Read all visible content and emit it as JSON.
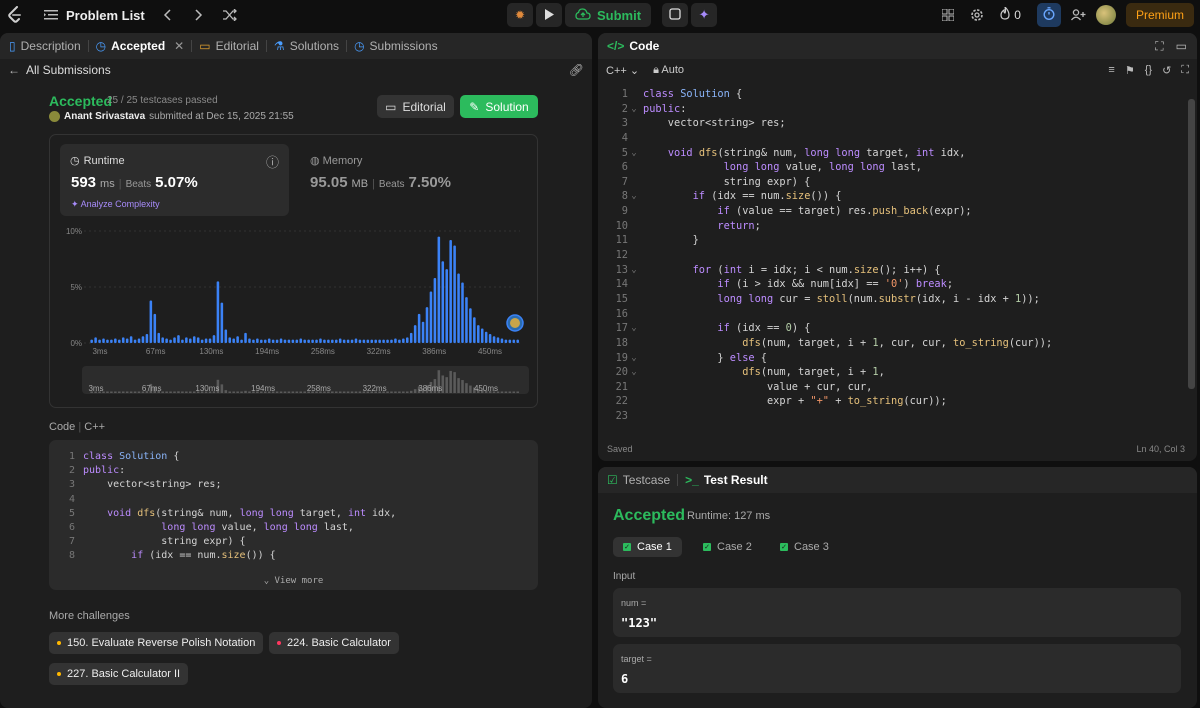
{
  "topbar": {
    "problem_list": "Problem List",
    "submit_label": "Submit",
    "streak_count": "0",
    "premium_label": "Premium"
  },
  "left_tabs": [
    {
      "label": "Description",
      "icon": "document-icon"
    },
    {
      "label": "Accepted",
      "icon": "history-icon"
    },
    {
      "label": "Editorial",
      "icon": "book-icon"
    },
    {
      "label": "Solutions",
      "icon": "flask-icon"
    },
    {
      "label": "Submissions",
      "icon": "history-icon"
    }
  ],
  "submission": {
    "back_label": "All Submissions",
    "status": "Accepted",
    "testcases": "25 / 25 testcases passed",
    "author": "Anant Srivastava",
    "submitted_at": "submitted at Dec 15, 2025 21:55",
    "editorial_btn": "Editorial",
    "solution_btn": "Solution"
  },
  "runtime": {
    "label": "Runtime",
    "value": "593",
    "unit": "ms",
    "beats_label": "Beats",
    "beats": "5.07%",
    "analyze": "Analyze Complexity"
  },
  "memory": {
    "label": "Memory",
    "value": "95.05",
    "unit": "MB",
    "beats_label": "Beats",
    "beats": "7.50%"
  },
  "chart_data": {
    "type": "bar",
    "y_ticks": [
      "10%",
      "5%",
      "0%"
    ],
    "ylim": [
      0,
      10
    ],
    "x_ticks": [
      "3ms",
      "67ms",
      "130ms",
      "194ms",
      "258ms",
      "322ms",
      "386ms",
      "450ms"
    ],
    "values": [
      0.3,
      0.5,
      0.3,
      0.4,
      0.3,
      0.3,
      0.4,
      0.3,
      0.5,
      0.4,
      0.6,
      0.3,
      0.4,
      0.6,
      0.8,
      3.8,
      2.6,
      0.9,
      0.5,
      0.4,
      0.3,
      0.5,
      0.7,
      0.3,
      0.5,
      0.4,
      0.6,
      0.5,
      0.3,
      0.4,
      0.4,
      0.7,
      5.5,
      3.6,
      1.2,
      0.5,
      0.4,
      0.6,
      0.3,
      0.9,
      0.4,
      0.3,
      0.4,
      0.3,
      0.3,
      0.4,
      0.3,
      0.3,
      0.4,
      0.3,
      0.3,
      0.3,
      0.3,
      0.4,
      0.3,
      0.3,
      0.3,
      0.3,
      0.4,
      0.3,
      0.3,
      0.3,
      0.3,
      0.4,
      0.3,
      0.3,
      0.3,
      0.4,
      0.3,
      0.3,
      0.3,
      0.3,
      0.3,
      0.3,
      0.3,
      0.3,
      0.3,
      0.4,
      0.3,
      0.4,
      0.5,
      0.9,
      1.6,
      2.6,
      1.9,
      3.2,
      4.6,
      5.8,
      9.5,
      7.3,
      6.6,
      9.2,
      8.7,
      6.2,
      5.4,
      4.1,
      3.1,
      2.3,
      1.6,
      1.3,
      1.0,
      0.8,
      0.6,
      0.5,
      0.4,
      0.3,
      0.3,
      0.3,
      0.3
    ],
    "highlight_x": "593ms"
  },
  "code_section": {
    "label": "Code",
    "lang": "C++",
    "view_more": "View more",
    "lines": [
      [
        {
          "c": "kw",
          "t": "class"
        },
        {
          "c": "tx",
          "t": " "
        },
        {
          "c": "ty",
          "t": "Solution"
        },
        {
          "c": "tx",
          "t": " {"
        }
      ],
      [
        {
          "c": "kw",
          "t": "public"
        },
        {
          "c": "tx",
          "t": ":"
        }
      ],
      [
        {
          "c": "tx",
          "t": "    vector<string> res;"
        }
      ],
      [
        {
          "c": "tx",
          "t": ""
        }
      ],
      [
        {
          "c": "tx",
          "t": "    "
        },
        {
          "c": "kw",
          "t": "void"
        },
        {
          "c": "tx",
          "t": " "
        },
        {
          "c": "fn",
          "t": "dfs"
        },
        {
          "c": "tx",
          "t": "(string& num, "
        },
        {
          "c": "kw",
          "t": "long long"
        },
        {
          "c": "tx",
          "t": " target, "
        },
        {
          "c": "kw",
          "t": "int"
        },
        {
          "c": "tx",
          "t": " idx,"
        }
      ],
      [
        {
          "c": "tx",
          "t": "             "
        },
        {
          "c": "kw",
          "t": "long long"
        },
        {
          "c": "tx",
          "t": " value, "
        },
        {
          "c": "kw",
          "t": "long long"
        },
        {
          "c": "tx",
          "t": " last,"
        }
      ],
      [
        {
          "c": "tx",
          "t": "             string expr) {"
        }
      ],
      [
        {
          "c": "tx",
          "t": "        "
        },
        {
          "c": "kw",
          "t": "if"
        },
        {
          "c": "tx",
          "t": " (idx == num."
        },
        {
          "c": "fn",
          "t": "size"
        },
        {
          "c": "tx",
          "t": "()) {"
        }
      ]
    ]
  },
  "more_challenges": {
    "label": "More challenges",
    "items": [
      {
        "label": "150. Evaluate Reverse Polish Notation",
        "level": "medium"
      },
      {
        "label": "224. Basic Calculator",
        "level": "hard"
      },
      {
        "label": "227. Basic Calculator II",
        "level": "medium"
      }
    ]
  },
  "editor": {
    "title": "Code",
    "language": "C++",
    "mode": "Auto",
    "status": "Saved",
    "cursor": "Ln 40, Col 3",
    "lines": [
      {
        "n": "1",
        "f": "",
        "s": [
          {
            "c": "kw",
            "t": "class"
          },
          {
            "c": "tx",
            "t": " "
          },
          {
            "c": "ty",
            "t": "Solution"
          },
          {
            "c": "tx",
            "t": " {"
          }
        ]
      },
      {
        "n": "2",
        "f": "v",
        "s": [
          {
            "c": "kw",
            "t": "public"
          },
          {
            "c": "tx",
            "t": ":"
          }
        ]
      },
      {
        "n": "3",
        "f": "",
        "s": [
          {
            "c": "tx",
            "t": "    vector<string> res;"
          }
        ]
      },
      {
        "n": "4",
        "f": "",
        "s": [
          {
            "c": "tx",
            "t": ""
          }
        ]
      },
      {
        "n": "5",
        "f": "v",
        "s": [
          {
            "c": "tx",
            "t": "    "
          },
          {
            "c": "kw",
            "t": "void"
          },
          {
            "c": "tx",
            "t": " "
          },
          {
            "c": "fn",
            "t": "dfs"
          },
          {
            "c": "tx",
            "t": "(string& num, "
          },
          {
            "c": "kw",
            "t": "long long"
          },
          {
            "c": "tx",
            "t": " target, "
          },
          {
            "c": "kw",
            "t": "int"
          },
          {
            "c": "tx",
            "t": " idx,"
          }
        ]
      },
      {
        "n": "6",
        "f": "",
        "s": [
          {
            "c": "tx",
            "t": "             "
          },
          {
            "c": "kw",
            "t": "long long"
          },
          {
            "c": "tx",
            "t": " value, "
          },
          {
            "c": "kw",
            "t": "long long"
          },
          {
            "c": "tx",
            "t": " last,"
          }
        ]
      },
      {
        "n": "7",
        "f": "",
        "s": [
          {
            "c": "tx",
            "t": "             string expr) {"
          }
        ]
      },
      {
        "n": "8",
        "f": "v",
        "s": [
          {
            "c": "tx",
            "t": "        "
          },
          {
            "c": "kw",
            "t": "if"
          },
          {
            "c": "tx",
            "t": " (idx == num."
          },
          {
            "c": "fn",
            "t": "size"
          },
          {
            "c": "tx",
            "t": "()) {"
          }
        ]
      },
      {
        "n": "9",
        "f": "",
        "s": [
          {
            "c": "tx",
            "t": "            "
          },
          {
            "c": "kw",
            "t": "if"
          },
          {
            "c": "tx",
            "t": " (value == target) res."
          },
          {
            "c": "fn",
            "t": "push_back"
          },
          {
            "c": "tx",
            "t": "(expr);"
          }
        ]
      },
      {
        "n": "10",
        "f": "",
        "s": [
          {
            "c": "tx",
            "t": "            "
          },
          {
            "c": "kw",
            "t": "return"
          },
          {
            "c": "tx",
            "t": ";"
          }
        ]
      },
      {
        "n": "11",
        "f": "",
        "s": [
          {
            "c": "tx",
            "t": "        }"
          }
        ]
      },
      {
        "n": "12",
        "f": "",
        "s": [
          {
            "c": "tx",
            "t": ""
          }
        ]
      },
      {
        "n": "13",
        "f": "v",
        "s": [
          {
            "c": "tx",
            "t": "        "
          },
          {
            "c": "kw",
            "t": "for"
          },
          {
            "c": "tx",
            "t": " ("
          },
          {
            "c": "kw",
            "t": "int"
          },
          {
            "c": "tx",
            "t": " i = idx; i < num."
          },
          {
            "c": "fn",
            "t": "size"
          },
          {
            "c": "tx",
            "t": "(); i++) {"
          }
        ]
      },
      {
        "n": "14",
        "f": "",
        "s": [
          {
            "c": "tx",
            "t": "            "
          },
          {
            "c": "kw",
            "t": "if"
          },
          {
            "c": "tx",
            "t": " (i > idx && num[idx] == "
          },
          {
            "c": "st",
            "t": "'0'"
          },
          {
            "c": "tx",
            "t": ") "
          },
          {
            "c": "kw",
            "t": "break"
          },
          {
            "c": "tx",
            "t": ";"
          }
        ]
      },
      {
        "n": "15",
        "f": "",
        "s": [
          {
            "c": "tx",
            "t": "            "
          },
          {
            "c": "kw",
            "t": "long long"
          },
          {
            "c": "tx",
            "t": " cur = "
          },
          {
            "c": "fn",
            "t": "stoll"
          },
          {
            "c": "tx",
            "t": "(num."
          },
          {
            "c": "fn",
            "t": "substr"
          },
          {
            "c": "tx",
            "t": "(idx, i - idx + "
          },
          {
            "c": "nm",
            "t": "1"
          },
          {
            "c": "tx",
            "t": "));"
          }
        ]
      },
      {
        "n": "16",
        "f": "",
        "s": [
          {
            "c": "tx",
            "t": ""
          }
        ]
      },
      {
        "n": "17",
        "f": "v",
        "s": [
          {
            "c": "tx",
            "t": "            "
          },
          {
            "c": "kw",
            "t": "if"
          },
          {
            "c": "tx",
            "t": " (idx == "
          },
          {
            "c": "nm",
            "t": "0"
          },
          {
            "c": "tx",
            "t": ") {"
          }
        ]
      },
      {
        "n": "18",
        "f": "",
        "s": [
          {
            "c": "tx",
            "t": "                "
          },
          {
            "c": "fn",
            "t": "dfs"
          },
          {
            "c": "tx",
            "t": "(num, target, i + "
          },
          {
            "c": "nm",
            "t": "1"
          },
          {
            "c": "tx",
            "t": ", cur, cur, "
          },
          {
            "c": "fn",
            "t": "to_string"
          },
          {
            "c": "tx",
            "t": "(cur));"
          }
        ]
      },
      {
        "n": "19",
        "f": "v",
        "s": [
          {
            "c": "tx",
            "t": "            } "
          },
          {
            "c": "kw",
            "t": "else"
          },
          {
            "c": "tx",
            "t": " {"
          }
        ]
      },
      {
        "n": "20",
        "f": "v",
        "s": [
          {
            "c": "tx",
            "t": "                "
          },
          {
            "c": "fn",
            "t": "dfs"
          },
          {
            "c": "tx",
            "t": "(num, target, i + "
          },
          {
            "c": "nm",
            "t": "1"
          },
          {
            "c": "tx",
            "t": ","
          }
        ]
      },
      {
        "n": "21",
        "f": "",
        "s": [
          {
            "c": "tx",
            "t": "                    value + cur, cur,"
          }
        ]
      },
      {
        "n": "22",
        "f": "",
        "s": [
          {
            "c": "tx",
            "t": "                    expr + "
          },
          {
            "c": "st",
            "t": "\"+\""
          },
          {
            "c": "tx",
            "t": " + "
          },
          {
            "c": "fn",
            "t": "to_string"
          },
          {
            "c": "tx",
            "t": "(cur));"
          }
        ]
      },
      {
        "n": "23",
        "f": "",
        "s": [
          {
            "c": "tx",
            "t": ""
          }
        ]
      }
    ]
  },
  "result": {
    "tab_testcase": "Testcase",
    "tab_result": "Test Result",
    "status": "Accepted",
    "runtime": "Runtime: 127 ms",
    "cases": [
      "Case 1",
      "Case 2",
      "Case 3"
    ],
    "input_label": "Input",
    "inputs": [
      {
        "key": "num =",
        "value": "\"123\""
      },
      {
        "key": "target =",
        "value": "6"
      }
    ]
  },
  "colors": {
    "accent_green": "#2cbb5d",
    "premium": "#ffa116",
    "bar": "#3b82f6"
  }
}
